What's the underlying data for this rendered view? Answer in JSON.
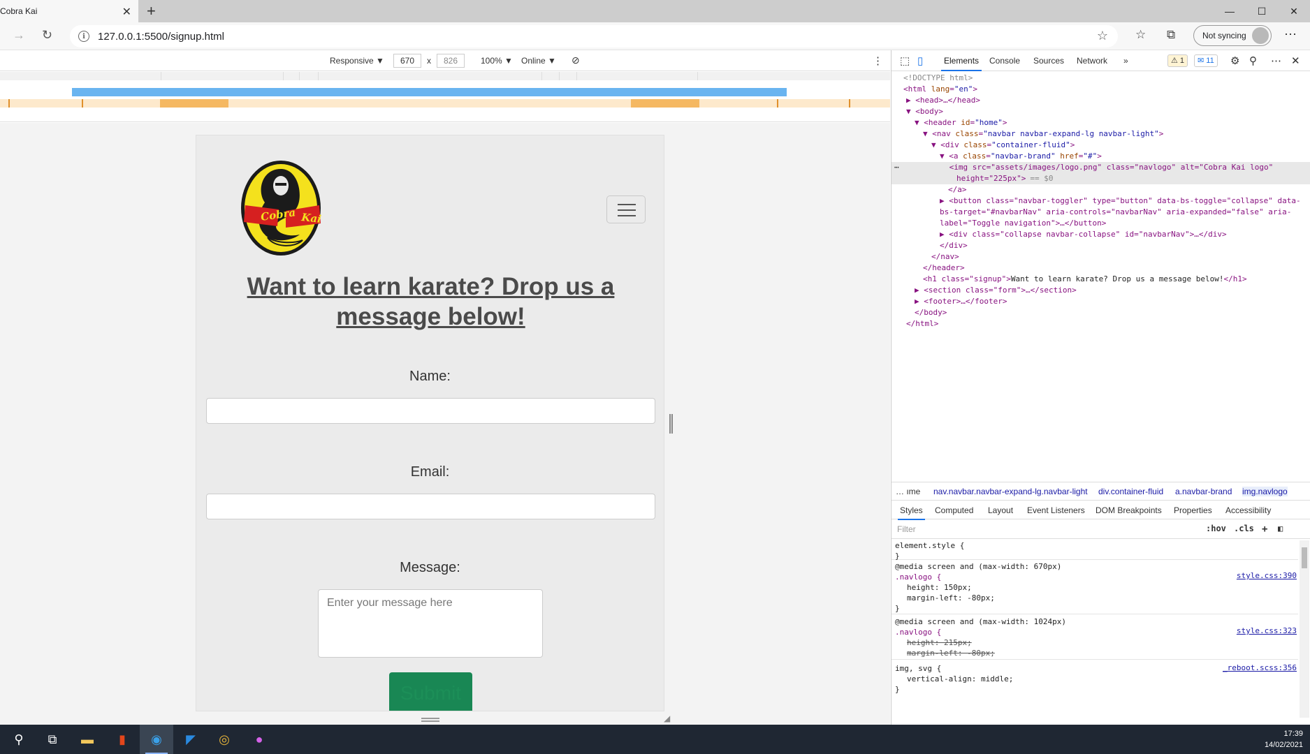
{
  "browser": {
    "tab_title": "Cobra Kai",
    "tab_close": "✕",
    "new_tab": "+",
    "window_controls": {
      "minimize": "—",
      "maximize": "☐",
      "close": "✕"
    },
    "back": "→",
    "refresh": "↻",
    "url": "127.0.0.1:5500/signup.html",
    "sync_label": "Not syncing",
    "more": "⋯"
  },
  "device_toolbar": {
    "mode": "Responsive ▼",
    "width": "670",
    "times": "x",
    "height": "826",
    "zoom": "100% ▼",
    "network": "Online ▼"
  },
  "page": {
    "logo_alt": "Cobra Kai logo",
    "logo_text": "Cobra Kai",
    "heading": "Want to learn karate? Drop us a message below!",
    "name_label": "Name:",
    "email_label": "Email:",
    "message_label": "Message:",
    "message_placeholder": "Enter your message here",
    "submit_label": "Submit"
  },
  "devtools": {
    "tabs": [
      "Elements",
      "Console",
      "Sources",
      "Network"
    ],
    "more_tabs": "»",
    "warnings": "⚠ 1",
    "messages": "✉ 11",
    "breadcrumbs": [
      "… ıme",
      "nav.navbar.navbar-expand-lg.navbar-light",
      "div.container-fluid",
      "a.navbar-brand",
      "img.navlogo"
    ],
    "styles_tabs": [
      "Styles",
      "Computed",
      "Layout",
      "Event Listeners",
      "DOM Breakpoints",
      "Properties",
      "Accessibility"
    ],
    "filter_placeholder": "Filter",
    "hov": ":hov",
    ".cls": ".cls",
    "dom": {
      "l1": "<!DOCTYPE html>",
      "l2_tag": "<html ",
      "l2_attr": "lang",
      "l2_val": "\"en\"",
      "l3": "<head>…</head>",
      "l4": "<body>",
      "l5_tag": "<header ",
      "l5_attr": "id",
      "l5_val": "\"home\"",
      "l6_tag": "<nav ",
      "l6_attr": "class",
      "l6_val": "\"navbar navbar-expand-lg navbar-light\"",
      "l7_tag": "<div ",
      "l7_attr": "class",
      "l7_val": "\"container-fluid\"",
      "l8_tag": "<a ",
      "l8_attr1": "class",
      "l8_val1": "\"navbar-brand\"",
      "l8_attr2": "href",
      "l8_val2": "\"#\"",
      "l9a": "<img src=\"assets/images/logo.png\" class=\"navlogo\" alt=\"Cobra Kai logo\"",
      "l9b": "height=\"225px\">",
      "l9c": "== $0",
      "l10": "</a>",
      "l11": "<button class=\"navbar-toggler\" type=\"button\" data-bs-toggle=\"collapse\" data-",
      "l12": "bs-target=\"#navbarNav\" aria-controls=\"navbarNav\" aria-expanded=\"false\" aria-",
      "l13": "label=\"Toggle navigation\">…</button>",
      "l14": "<div class=\"collapse navbar-collapse\" id=\"navbarNav\">…</div>",
      "l15": "</div>",
      "l16": "</nav>",
      "l17": "</header>",
      "l18a": "<h1 class=\"signup\">",
      "l18b": "Want to learn karate? Drop us a message below!",
      "l18c": "</h1>",
      "l19": "<section class=\"form\">…</section>",
      "l20": "<footer>…</footer>",
      "l21": "</body>",
      "l22": "</html>"
    },
    "rules": {
      "r1_sel": "element.style {",
      "close": "}",
      "r2_media": "@media screen and (max-width: 670px)",
      "r2_sel": ".navlogo {",
      "r2_p1": "height: 150px;",
      "r2_p2": "margin-left: -80px;",
      "r2_src": "style.css:390",
      "r3_media": "@media screen and (max-width: 1024px)",
      "r3_sel": ".navlogo {",
      "r3_p1": "height: 215px;",
      "r3_p2": "margin-left: -80px;",
      "r3_src": "style.css:323",
      "r4_sel": "img, svg {",
      "r4_p1": "vertical-align: middle;",
      "r4_src": "_reboot.scss:356"
    }
  },
  "taskbar": {
    "time": "17:39",
    "date": "14/02/2021"
  },
  "colors": {
    "submit": "#198754",
    "devtools_accent": "#1a73e8",
    "media_bar_blue": "#6ab4f0",
    "media_bar_orange": "#f5b862"
  }
}
